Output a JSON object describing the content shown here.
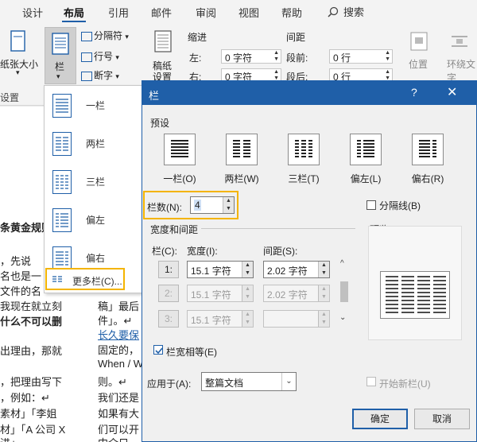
{
  "ribbon_tabs": [
    {
      "label": "设计"
    },
    {
      "label": "布局"
    },
    {
      "label": "引用"
    },
    {
      "label": "邮件"
    },
    {
      "label": "审阅"
    },
    {
      "label": "视图"
    },
    {
      "label": "帮助"
    }
  ],
  "search_label": "搜索",
  "ribbon": {
    "paper_size_label": "纸张大小",
    "columns_label": "栏",
    "breaks_label": "分隔符",
    "line_numbers_label": "行号",
    "hyphenation_label": "断字",
    "manuscript_label_1": "稿纸",
    "manuscript_label_2": "设置",
    "indent_header": "缩进",
    "spacing_header": "间距",
    "indent_left_label": "左:",
    "indent_left_value": "0 字符",
    "indent_right_label": "右:",
    "indent_right_value": "0 字符",
    "spacing_before_label": "段前:",
    "spacing_before_value": "0 行",
    "spacing_after_label": "段后:",
    "spacing_after_value": "0 行",
    "position_label": "位置",
    "wrap_label": "环绕文字",
    "group_setup_label": "设置"
  },
  "column_menu": {
    "items": [
      {
        "label": "一栏"
      },
      {
        "label": "两栏"
      },
      {
        "label": "三栏"
      },
      {
        "label": "偏左"
      },
      {
        "label": "偏右"
      }
    ],
    "more_label": "更多栏(C)..."
  },
  "document": {
    "left_lines": [
      "条黄金规则",
      "，先说",
      "名也是一",
      "文件的名",
      "我现在就立刻",
      "什么不可以删",
      "出理由，那就",
      "，把理由写下",
      "，例如：↵",
      "素材」「李姐",
      "材」「A 公司 X",
      "进」"
    ],
    "right_lines": [
      "稿」最后",
      "件」。↵",
      "长久要保",
      "固定的，",
      "When / W",
      "则。↵",
      "我们还是",
      "如果有大",
      "们可以开",
      "内介只"
    ]
  },
  "dialog": {
    "title": "栏",
    "help": "?",
    "close": "✕",
    "presets_label": "预设",
    "presets": [
      {
        "label": "一栏(O)"
      },
      {
        "label": "两栏(W)"
      },
      {
        "label": "三栏(T)"
      },
      {
        "label": "偏左(L)"
      },
      {
        "label": "偏右(R)"
      }
    ],
    "num_columns_label": "栏数(N):",
    "num_columns_value": "4",
    "line_between_label": "分隔线(B)",
    "width_spacing_label": "宽度和间距",
    "preview_label": "预览",
    "col_header": "栏(C):",
    "width_header": "宽度(I):",
    "spacing_header": "间距(S):",
    "rows": [
      {
        "num": "1:",
        "width": "15.1 字符",
        "spacing": "2.02 字符"
      },
      {
        "num": "2:",
        "width": "15.1 字符",
        "spacing": "2.02 字符"
      },
      {
        "num": "3:",
        "width": "15.1 字符",
        "spacing": ""
      }
    ],
    "equal_width_label": "栏宽相等(E)",
    "apply_to_label": "应用于(A):",
    "apply_to_value": "整篇文档",
    "new_column_label": "开始新栏(U)",
    "ok_label": "确定",
    "cancel_label": "取消"
  },
  "colors": {
    "accent": "#1f5fa8",
    "highlight": "#f4b400",
    "ribbon_bg": "#f3f3f3",
    "dialog_bg": "#f0f0f0"
  }
}
